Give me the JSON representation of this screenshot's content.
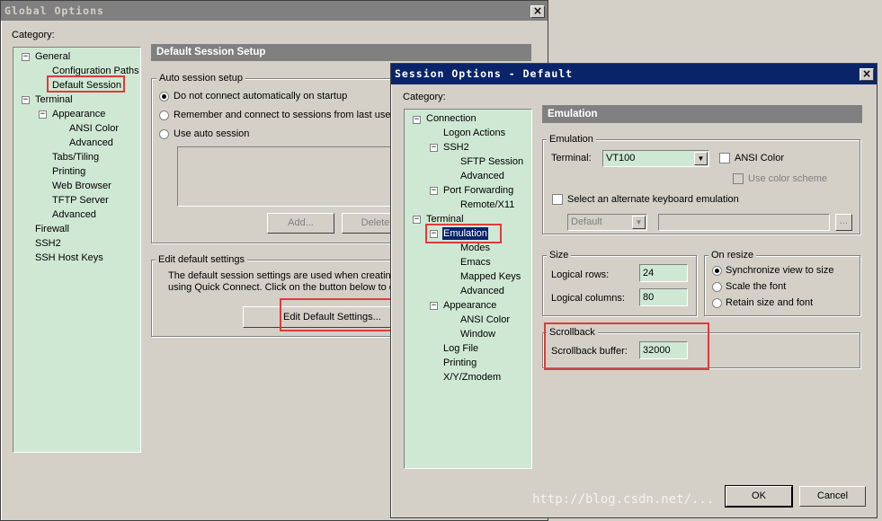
{
  "global": {
    "title": "Global Options",
    "category_label": "Category:",
    "tree": [
      {
        "label": "General",
        "expander": "−"
      },
      {
        "label": "Configuration Paths"
      },
      {
        "label": "Default Session"
      },
      {
        "label": "Terminal",
        "expander": "−"
      },
      {
        "label": "Appearance",
        "expander": "−"
      },
      {
        "label": "ANSI Color"
      },
      {
        "label": "Advanced"
      },
      {
        "label": "Tabs/Tiling"
      },
      {
        "label": "Printing"
      },
      {
        "label": "Web Browser"
      },
      {
        "label": "TFTP Server"
      },
      {
        "label": "Advanced"
      },
      {
        "label": "Firewall"
      },
      {
        "label": "SSH2"
      },
      {
        "label": "SSH Host Keys"
      }
    ],
    "section_title": "Default Session Setup",
    "auto_session": {
      "label": "Auto session setup",
      "options": [
        "Do not connect automatically on startup",
        "Remember and connect to sessions from last use",
        "Use auto session"
      ],
      "add_label": "Add...",
      "delete_label": "Delete"
    },
    "edit_defaults": {
      "label": "Edit default settings",
      "desc_line1": "The default session settings are used when creating",
      "desc_line2": "using Quick Connect.  Click on the button below to c",
      "button_label": "Edit Default Settings..."
    }
  },
  "session": {
    "title": "Session Options - Default",
    "category_label": "Category:",
    "tree": [
      {
        "label": "Connection",
        "expander": "−"
      },
      {
        "label": "Logon Actions"
      },
      {
        "label": "SSH2",
        "expander": "−"
      },
      {
        "label": "SFTP Session"
      },
      {
        "label": "Advanced"
      },
      {
        "label": "Port Forwarding",
        "expander": "−"
      },
      {
        "label": "Remote/X11"
      },
      {
        "label": "Terminal",
        "expander": "−"
      },
      {
        "label": "Emulation",
        "expander": "−"
      },
      {
        "label": "Modes"
      },
      {
        "label": "Emacs"
      },
      {
        "label": "Mapped Keys"
      },
      {
        "label": "Advanced"
      },
      {
        "label": "Appearance",
        "expander": "−"
      },
      {
        "label": "ANSI Color"
      },
      {
        "label": "Window"
      },
      {
        "label": "Log File"
      },
      {
        "label": "Printing"
      },
      {
        "label": "X/Y/Zmodem"
      }
    ],
    "section_title": "Emulation",
    "emulation": {
      "label": "Emulation",
      "terminal_label": "Terminal:",
      "terminal_value": "VT100",
      "ansi_color_label": "ANSI Color",
      "use_color_scheme_label": "Use color scheme",
      "alt_keyboard_label": "Select an alternate keyboard emulation",
      "keyboard_value": "Default",
      "browse_label": "..."
    },
    "size": {
      "label": "Size",
      "rows_label": "Logical rows:",
      "rows_value": "24",
      "cols_label": "Logical columns:",
      "cols_value": "80"
    },
    "on_resize": {
      "label": "On resize",
      "options": [
        "Synchronize view to size",
        "Scale the font",
        "Retain size and font"
      ]
    },
    "scrollback": {
      "label": "Scrollback",
      "buffer_label": "Scrollback buffer:",
      "buffer_value": "32000"
    },
    "ok_label": "OK",
    "cancel_label": "Cancel"
  },
  "watermark": "http://blog.csdn.net/..."
}
